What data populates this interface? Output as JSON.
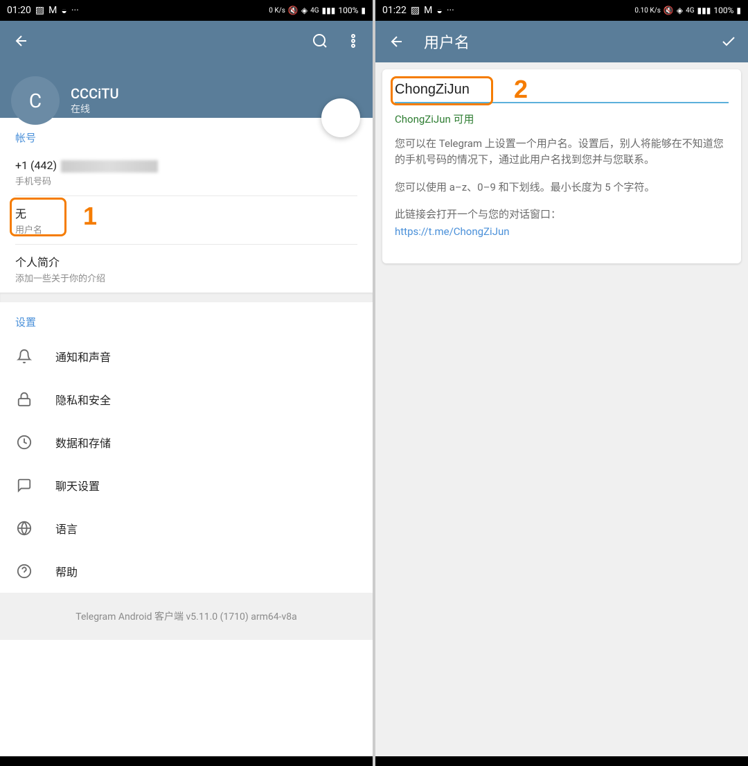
{
  "left": {
    "status": {
      "time": "01:20",
      "speed": "0 K/s",
      "battery": "100%",
      "signal": "4G"
    },
    "profile": {
      "avatar_initial": "C",
      "name": "CCCiTU",
      "status": "在线"
    },
    "account": {
      "section_label": "帐号",
      "phone_prefix": "+1 (442)",
      "phone_sub": "手机号码",
      "username_value": "无",
      "username_sub": "用户名",
      "bio_label": "个人简介",
      "bio_sub": "添加一些关于你的介绍"
    },
    "settings": {
      "section_label": "设置",
      "items": [
        {
          "label": "通知和声音",
          "icon": "bell-icon"
        },
        {
          "label": "隐私和安全",
          "icon": "lock-icon"
        },
        {
          "label": "数据和存储",
          "icon": "data-icon"
        },
        {
          "label": "聊天设置",
          "icon": "chat-icon"
        },
        {
          "label": "语言",
          "icon": "globe-icon"
        },
        {
          "label": "帮助",
          "icon": "help-icon"
        }
      ]
    },
    "footer": "Telegram Android 客户端 v5.11.0 (1710) arm64-v8a",
    "annotation": "1"
  },
  "right": {
    "status": {
      "time": "01:22",
      "speed": "0.10 K/s",
      "battery": "100%",
      "signal": "4G"
    },
    "header_title": "用户名",
    "input_value": "ChongZiJun",
    "status_text": "ChongZiJun 可用",
    "help1": "您可以在 Telegram 上设置一个用户名。设置后，别人将能够在不知道您的手机号码的情况下，通过此用户名找到您并与您联系。",
    "help2": "您可以使用 a–z、0–9 和下划线。最小长度为 5 个字符。",
    "help3": "此链接会打开一个与您的对话窗口：",
    "link": "https://t.me/ChongZiJun",
    "annotation": "2"
  }
}
